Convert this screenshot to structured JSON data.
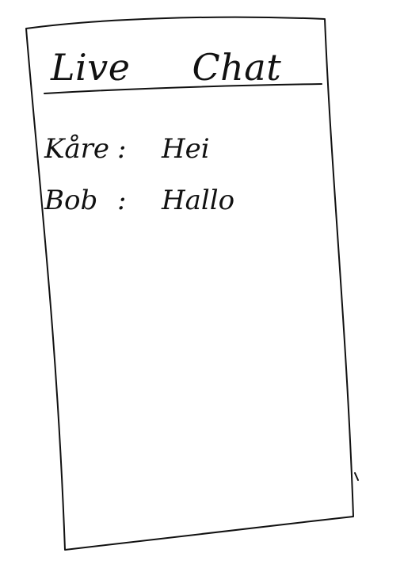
{
  "chat": {
    "title_words": [
      "Live",
      "Chat"
    ],
    "messages": [
      {
        "sender": "Kåre",
        "separator": ":",
        "text": "Hei"
      },
      {
        "sender": "Bob",
        "separator": ":",
        "text": "Hallo"
      }
    ]
  },
  "colors": {
    "ink": "#111111",
    "paper": "#ffffff"
  }
}
